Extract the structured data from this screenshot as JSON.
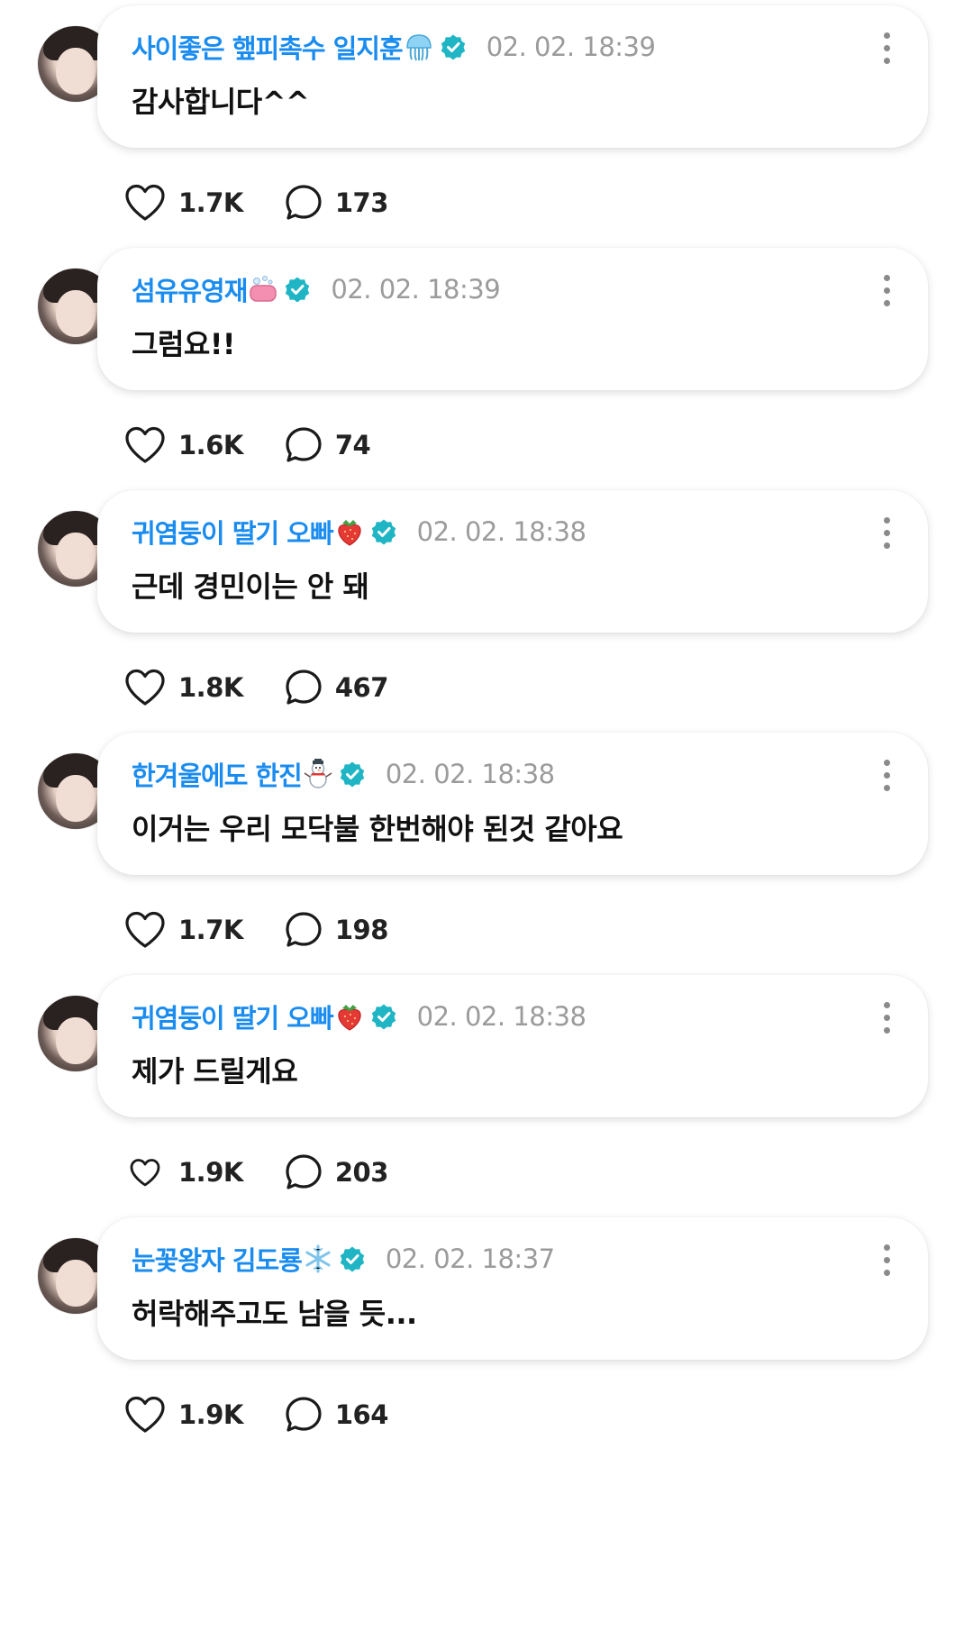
{
  "comments": [
    {
      "author": "사이좋은 햎피촉수 일지훈",
      "emoji": "jellyfish-emoji",
      "time": "02. 02. 18:39",
      "text": "감사합니다^^",
      "likes": "1.7K",
      "replies": "173"
    },
    {
      "author": "섬유유영재",
      "emoji": "soap-emoji",
      "time": "02. 02. 18:39",
      "text": "그럼요!!",
      "likes": "1.6K",
      "replies": "74"
    },
    {
      "author": "귀염둥이 딸기 오빠",
      "emoji": "strawberry-emoji",
      "time": "02. 02. 18:38",
      "text": "근데 경민이는 안 돼",
      "likes": "1.8K",
      "replies": "467"
    },
    {
      "author": "한겨울에도 한진",
      "emoji": "snowman-emoji",
      "time": "02. 02. 18:38",
      "text": "이거는 우리 모닥불 한번해야 된것 같아요",
      "likes": "1.7K",
      "replies": "198"
    },
    {
      "author": "귀염둥이 딸기 오빠",
      "emoji": "strawberry-emoji",
      "time": "02. 02. 18:38",
      "text": "제가 드릴게요",
      "likes": "1.9K",
      "replies": "203"
    },
    {
      "author": "눈꽃왕자 김도룡",
      "emoji": "snowflake-emoji",
      "time": "02. 02. 18:37",
      "text": "허락해주고도 남을 듯...",
      "likes": "1.9K",
      "replies": "164"
    }
  ],
  "colors": {
    "author": "#1a8cf0",
    "verified": "#1fb5c4",
    "time": "#9b9b9b",
    "text": "#111111"
  }
}
